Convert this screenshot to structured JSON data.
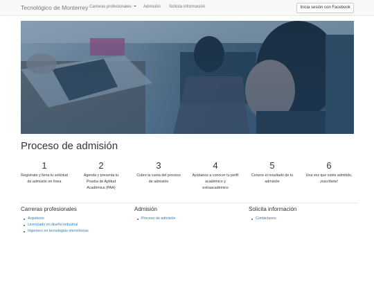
{
  "navbar": {
    "brand": "Tecnológico de Monterrey",
    "links": [
      "Carreras profesionales",
      "Admisión",
      "Solicita información"
    ],
    "facebook_button": "Inicia sesión con Facebook"
  },
  "hero": {
    "overlay_color": "#1f4a73"
  },
  "main": {
    "title": "Proceso de admisión",
    "steps": [
      {
        "number": "1",
        "text": "Regístrate y llena tu solicitud de admisión en línea"
      },
      {
        "number": "2",
        "text": "Agenda y presenta tu Prueba de Aptitud Académica (PAA)"
      },
      {
        "number": "3",
        "text": "Cubre la cuota del proceso de admisión"
      },
      {
        "number": "4",
        "text": "Ayúdanos a conocer tu perfil académico y extraacadémico"
      },
      {
        "number": "5",
        "text": "Conoce el resultado de tu admisión"
      },
      {
        "number": "6",
        "text": "Una vez que estés admitido, ¡inscríbete!"
      }
    ]
  },
  "footer": {
    "careers": {
      "title": "Carreras profesionales",
      "links": [
        "Arquitecto",
        "Licenciado en diseño industrial",
        "Ingeniero en tecnologías electrónicas"
      ]
    },
    "admission": {
      "title": "Admisión",
      "links": [
        "Proceso de admisión"
      ]
    },
    "info": {
      "title": "Solicita información",
      "links": [
        "Contáctanos"
      ]
    }
  },
  "colors": {
    "link": "#337ab7",
    "navbar_bg": "#f8f8f8"
  }
}
